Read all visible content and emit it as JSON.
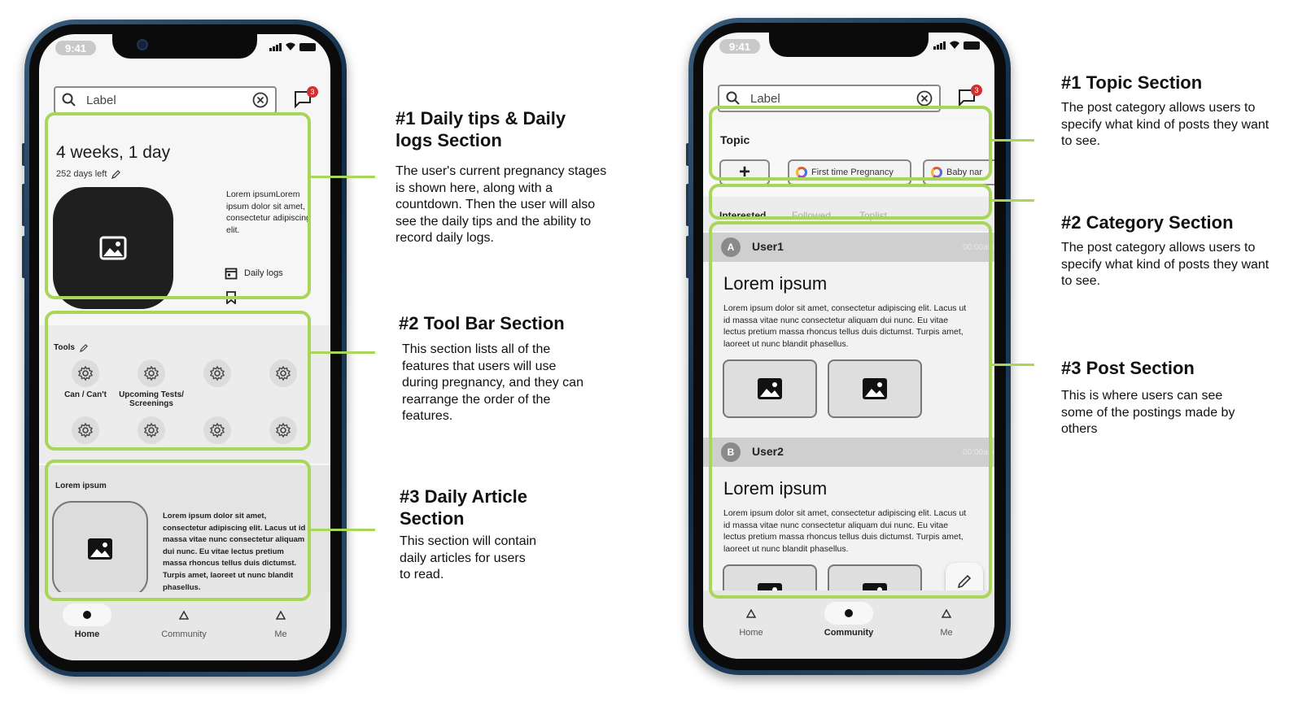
{
  "status_time": "9:41",
  "search_placeholder": "Label",
  "notification_count": "3",
  "left_phone": {
    "pregnancy": {
      "weeks": "4 weeks, 1 day",
      "days_left": "252 days left",
      "tip_text": "Lorem ipsumLorem ipsum dolor sit amet, consectetur adipiscing elit.",
      "daily_logs": "Daily logs"
    },
    "tools": {
      "title": "Tools",
      "items": [
        "Can / Can't",
        "Upcoming Tests/ Screenings",
        "",
        "",
        "",
        "",
        "",
        ""
      ]
    },
    "article": {
      "title": "Lorem ipsum",
      "body": "Lorem ipsum dolor sit amet, consectetur adipiscing elit. Lacus ut id massa vitae nunc consectetur aliquam dui nunc. Eu vitae lectus pretium massa rhoncus tellus duis dictumst. Turpis amet, laoreet ut nunc blandit phasellus."
    },
    "nav": [
      {
        "label": "Home",
        "active": true
      },
      {
        "label": "Community",
        "active": false
      },
      {
        "label": "Me",
        "active": false
      }
    ]
  },
  "left_annotations": [
    {
      "title": "#1 Daily tips & Daily logs Section",
      "body": "The user's current pregnancy stages is shown here, along with a countdown. Then the user will also see the daily tips and the ability to record daily logs."
    },
    {
      "title": "#2 Tool Bar Section",
      "body": "This section lists all of the features that users will use during pregnancy, and they can rearrange the order of the features."
    },
    {
      "title": "#3 Daily Article Section",
      "body": "This section will contain daily articles for users to read."
    }
  ],
  "right_phone": {
    "topic": {
      "title": "Topic",
      "add_label": "+",
      "chips": [
        "First time Pregnancy",
        "Baby nar"
      ]
    },
    "tabs": [
      {
        "label": "Interested",
        "active": true
      },
      {
        "label": "Followed",
        "active": false
      },
      {
        "label": "Toplist",
        "active": false
      }
    ],
    "posts": [
      {
        "avatar": "A",
        "user": "User1",
        "time": "00:00am",
        "title": "Lorem ipsum",
        "body": "Lorem ipsum dolor sit amet, consectetur adipiscing elit. Lacus ut id massa vitae nunc consectetur aliquam dui nunc. Eu vitae lectus pretium massa rhoncus tellus duis dictumst. Turpis amet, laoreet ut nunc blandit phasellus."
      },
      {
        "avatar": "B",
        "user": "User2",
        "time": "00:00am",
        "title": "Lorem ipsum",
        "body": "Lorem ipsum dolor sit amet, consectetur adipiscing elit. Lacus ut id massa vitae nunc consectetur aliquam dui nunc. Eu vitae lectus pretium massa rhoncus tellus duis dictumst. Turpis amet, laoreet ut nunc blandit phasellus."
      }
    ],
    "nav": [
      {
        "label": "Home",
        "active": false
      },
      {
        "label": "Community",
        "active": true
      },
      {
        "label": "Me",
        "active": false
      }
    ]
  },
  "right_annotations": [
    {
      "title": "#1 Topic Section",
      "body": "The post category allows users to specify what kind of posts they want to see."
    },
    {
      "title": "#2 Category Section",
      "body": "The post category allows users to specify what kind of posts they want to see."
    },
    {
      "title": "#3 Post Section",
      "body": "This is where users can see some of the postings made by others"
    }
  ],
  "colors": {
    "highlight": "#a9d65a",
    "badge": "#d32f2f",
    "phone_frame": "#1f3d5c"
  }
}
